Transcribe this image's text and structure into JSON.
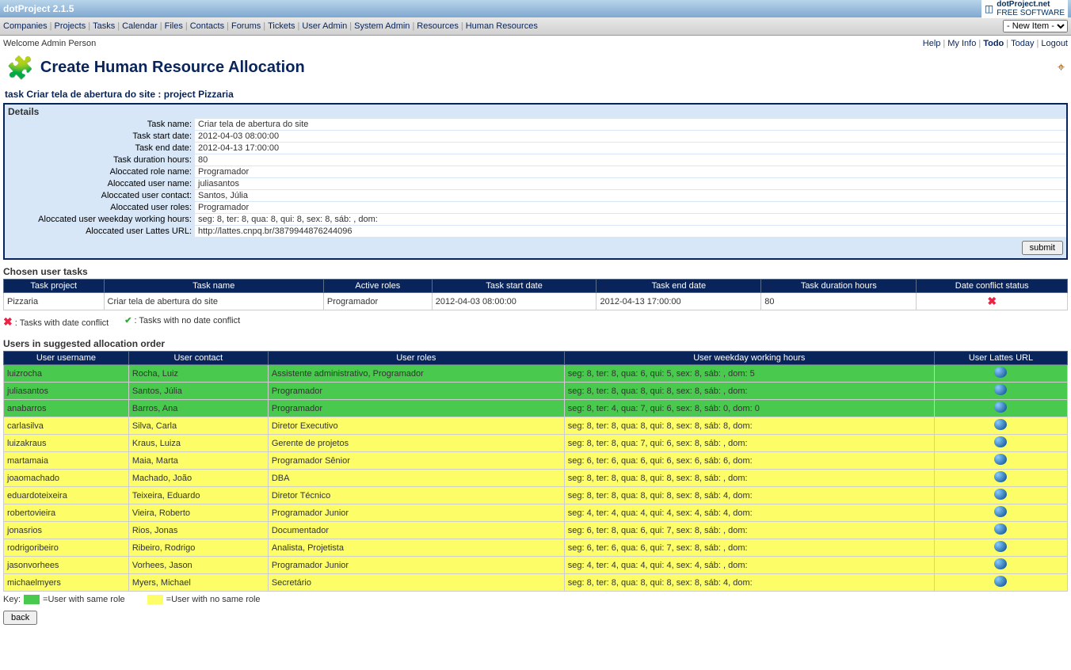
{
  "app": {
    "title": "dotProject 2.1.5",
    "logo_top": "dotProject.net",
    "logo_sub": "FREE SOFTWARE"
  },
  "nav": [
    "Companies",
    "Projects",
    "Tasks",
    "Calendar",
    "Files",
    "Contacts",
    "Forums",
    "Tickets",
    "User Admin",
    "System Admin",
    "Resources",
    "Human Resources"
  ],
  "new_item": {
    "placeholder": "- New Item -"
  },
  "welcome": {
    "text": "Welcome Admin Person",
    "links": [
      "Help",
      "My Info",
      "Todo",
      "Today",
      "Logout"
    ],
    "active": "Todo"
  },
  "page": {
    "title": "Create Human Resource Allocation",
    "subtitle": "task Criar tela de abertura do site : project Pizzaria"
  },
  "details": {
    "header": "Details",
    "rows": [
      {
        "label": "Task name:",
        "value": "Criar tela de abertura do site"
      },
      {
        "label": "Task start date:",
        "value": "2012-04-03 08:00:00"
      },
      {
        "label": "Task end date:",
        "value": "2012-04-13 17:00:00"
      },
      {
        "label": "Task duration hours:",
        "value": "80"
      },
      {
        "label": "Aloccated role name:",
        "value": "Programador"
      },
      {
        "label": "Aloccated user name:",
        "value": "juliasantos"
      },
      {
        "label": "Aloccated user contact:",
        "value": "Santos, Júlia"
      },
      {
        "label": "Aloccated user roles:",
        "value": "Programador"
      },
      {
        "label": "Aloccated user weekday working hours:",
        "value": "seg: 8, ter: 8, qua: 8, qui: 8, sex: 8, sáb: , dom:"
      },
      {
        "label": "Aloccated user Lattes URL:",
        "value": "http://lattes.cnpq.br/3879944876244096"
      }
    ],
    "submit": "submit"
  },
  "chosen": {
    "title": "Chosen user tasks",
    "headers": [
      "Task project",
      "Task name",
      "Active roles",
      "Task start date",
      "Task end date",
      "Task duration hours",
      "Date conflict status"
    ],
    "rows": [
      {
        "project": "Pizzaria",
        "name": "Criar tela de abertura do site",
        "roles": "Programador",
        "start": "2012-04-03 08:00:00",
        "end": "2012-04-13 17:00:00",
        "hours": "80",
        "conflict": true
      }
    ]
  },
  "legend": {
    "conflict": ": Tasks with date conflict",
    "noconflict": ": Tasks with no date conflict"
  },
  "users_section": {
    "title": "Users in suggested allocation order",
    "headers": [
      "User username",
      "User contact",
      "User roles",
      "User weekday working hours",
      "User Lattes URL"
    ]
  },
  "users": [
    {
      "cls": "green",
      "u": "luizrocha",
      "c": "Rocha, Luiz",
      "r": "Assistente administrativo, Programador",
      "h": "seg: 8, ter: 8, qua: 6, qui: 5, sex: 8, sáb: , dom: 5"
    },
    {
      "cls": "green",
      "u": "juliasantos",
      "c": "Santos, Júlia",
      "r": "Programador",
      "h": "seg: 8, ter: 8, qua: 8, qui: 8, sex: 8, sáb: , dom:"
    },
    {
      "cls": "green",
      "u": "anabarros",
      "c": "Barros, Ana",
      "r": "Programador",
      "h": "seg: 8, ter: 4, qua: 7, qui: 6, sex: 8, sáb: 0, dom: 0"
    },
    {
      "cls": "yellow",
      "u": "carlasilva",
      "c": "Silva, Carla",
      "r": "Diretor Executivo",
      "h": "seg: 8, ter: 8, qua: 8, qui: 8, sex: 8, sáb: 8, dom:"
    },
    {
      "cls": "yellow",
      "u": "luizakraus",
      "c": "Kraus, Luiza",
      "r": "Gerente de projetos",
      "h": "seg: 8, ter: 8, qua: 7, qui: 6, sex: 8, sáb: , dom:"
    },
    {
      "cls": "yellow",
      "u": "martamaia",
      "c": "Maia, Marta",
      "r": "Programador Sênior",
      "h": "seg: 6, ter: 6, qua: 6, qui: 6, sex: 6, sáb: 6, dom:"
    },
    {
      "cls": "yellow",
      "u": "joaomachado",
      "c": "Machado, João",
      "r": "DBA",
      "h": "seg: 8, ter: 8, qua: 8, qui: 8, sex: 8, sáb: , dom:"
    },
    {
      "cls": "yellow",
      "u": "eduardoteixeira",
      "c": "Teixeira, Eduardo",
      "r": "Diretor Técnico",
      "h": "seg: 8, ter: 8, qua: 8, qui: 8, sex: 8, sáb: 4, dom:"
    },
    {
      "cls": "yellow",
      "u": "robertovieira",
      "c": "Vieira, Roberto",
      "r": "Programador Junior",
      "h": "seg: 4, ter: 4, qua: 4, qui: 4, sex: 4, sáb: 4, dom:"
    },
    {
      "cls": "yellow",
      "u": "jonasrios",
      "c": "Rios, Jonas",
      "r": "Documentador",
      "h": "seg: 6, ter: 8, qua: 6, qui: 7, sex: 8, sáb: , dom:"
    },
    {
      "cls": "yellow",
      "u": "rodrigoribeiro",
      "c": "Ribeiro, Rodrigo",
      "r": "Analista, Projetista",
      "h": "seg: 6, ter: 6, qua: 6, qui: 7, sex: 8, sáb: , dom:"
    },
    {
      "cls": "yellow",
      "u": "jasonvorhees",
      "c": "Vorhees, Jason",
      "r": "Programador Junior",
      "h": "seg: 4, ter: 4, qua: 4, qui: 4, sex: 4, sáb: , dom:"
    },
    {
      "cls": "yellow",
      "u": "michaelmyers",
      "c": "Myers, Michael",
      "r": "Secretário",
      "h": "seg: 8, ter: 8, qua: 8, qui: 8, sex: 8, sáb: 4, dom:"
    }
  ],
  "key": {
    "label": "Key:",
    "green": "=User with same role",
    "yellow": "=User with no same role"
  },
  "back": "back"
}
